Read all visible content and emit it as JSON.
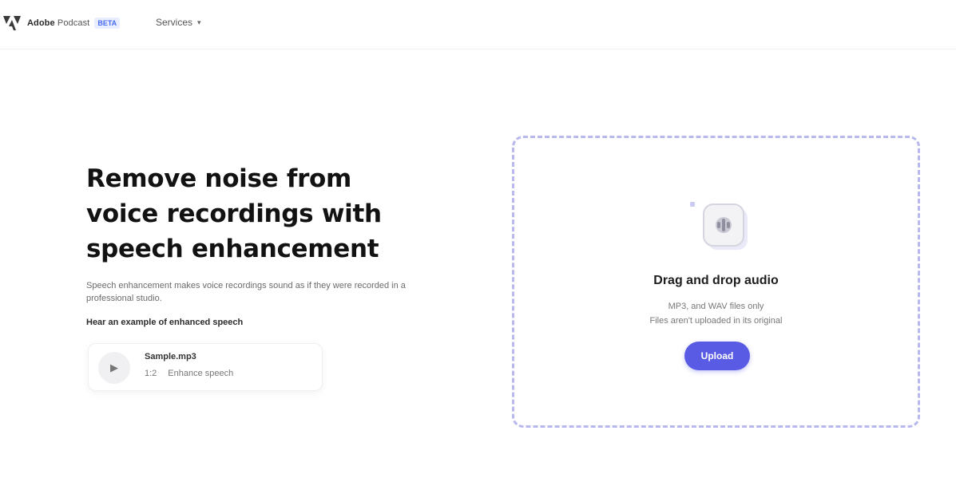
{
  "header": {
    "brand_name": "Adobe",
    "brand_sub": "Podcast",
    "brand_badge": "BETA",
    "menu_label": "Services"
  },
  "hero": {
    "title": "Remove noise from voice recordings with speech enhancement",
    "description": "Speech enhancement makes voice recordings sound as if they were recorded in a professional studio.",
    "sample_label": "Hear an example of enhanced speech"
  },
  "sample": {
    "title": "Sample.mp3",
    "duration": "1:2",
    "status": "Enhance speech"
  },
  "dropzone": {
    "title": "Drag and drop audio",
    "info_line1": "MP3, and WAV files only",
    "info_line2": "Files aren't uploaded in its original",
    "button_label": "Upload"
  },
  "icons": {
    "brand": "adobe-logo-icon",
    "menu": "chevron-down-icon",
    "play": "play-icon",
    "upload": "audio-file-icon"
  },
  "colors": {
    "accent": "#5a5be4",
    "dropzone_border": "#b6b8ee"
  }
}
